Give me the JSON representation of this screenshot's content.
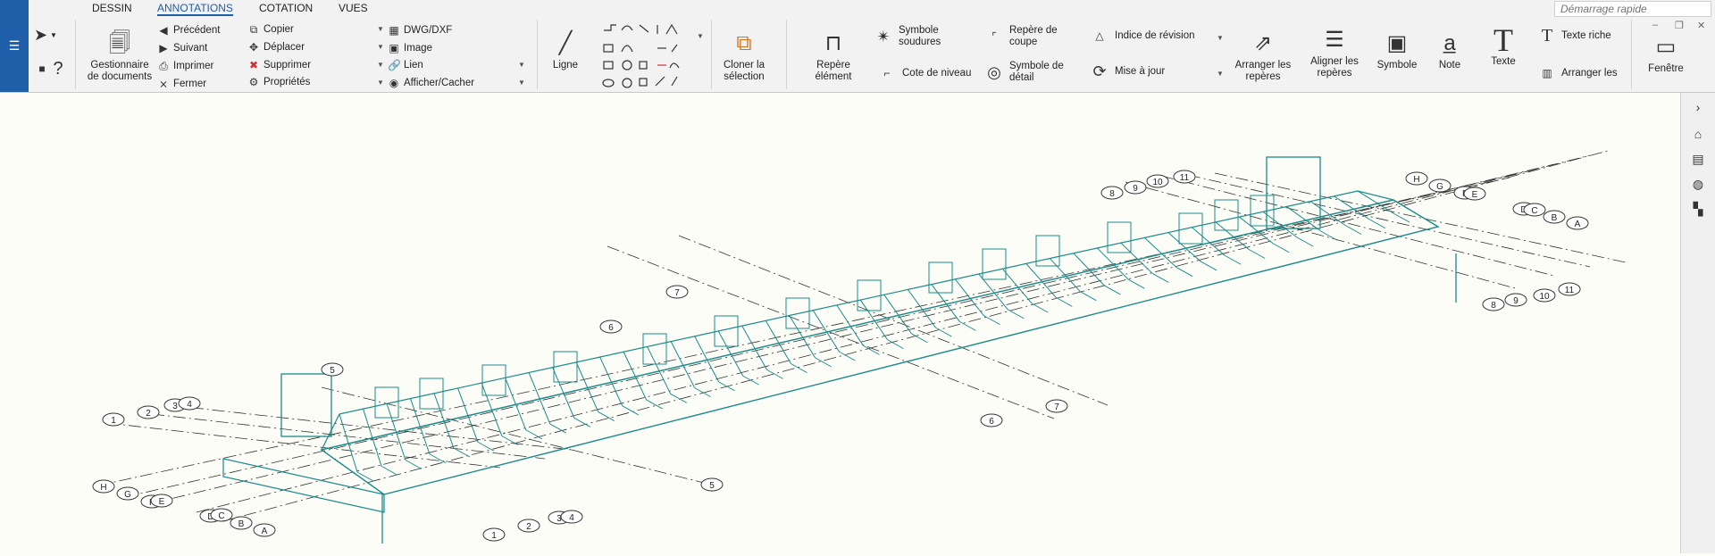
{
  "tabs": [
    "DESSIN",
    "ANNOTATIONS",
    "COTATION",
    "VUES"
  ],
  "active_tab": "ANNOTATIONS",
  "quick_start_placeholder": "Démarrage rapide",
  "window_controls": [
    "–",
    "❐",
    "✕"
  ],
  "toolbar": {
    "documents_manager": [
      "Gestionnaire",
      "de documents"
    ],
    "nav": {
      "previous": "Précédent",
      "next": "Suivant",
      "print": "Imprimer",
      "close": "Fermer"
    },
    "edit": {
      "copy": "Copier",
      "move": "Déplacer",
      "delete": "Supprimer",
      "properties": "Propriétés"
    },
    "insert": {
      "dwg": "DWG/DXF",
      "image": "Image",
      "link": "Lien",
      "show_hide": "Afficher/Cacher"
    },
    "line": "Ligne",
    "clone_selection": [
      "Cloner la",
      "sélection"
    ],
    "element_mark": [
      "Repère",
      "élément"
    ],
    "weld_symbol": [
      "Symbole",
      "soudures"
    ],
    "level_mark": "Cote de niveau",
    "section_mark": [
      "Repère de",
      "coupe"
    ],
    "detail_symbol": [
      "Symbole de",
      "détail"
    ],
    "revision_index": "Indice de révision",
    "update": "Mise à jour",
    "arrange_marks": [
      "Arranger les",
      "repères"
    ],
    "align_marks": [
      "Aligner les",
      "repères"
    ],
    "symbol": "Symbole",
    "note": "Note",
    "text": "Texte",
    "rich_text": "Texte riche",
    "arrange_the": "Arranger les",
    "window": "Fenêtre"
  },
  "grid_labels": {
    "left_numbers": [
      "1",
      "2",
      "3",
      "4"
    ],
    "left_letters": [
      "H",
      "G",
      "F",
      "E",
      "D",
      "C",
      "B",
      "A"
    ],
    "mid_numbers": [
      "5",
      "6",
      "7"
    ],
    "right_numbers": [
      "8",
      "9",
      "10",
      "11"
    ],
    "right_letters": [
      "H",
      "G",
      "F",
      "E",
      "D",
      "C",
      "B",
      "A"
    ]
  },
  "colors": {
    "accent": "#1f5ea8",
    "model": "#1a8a8a",
    "ribbon_bg": "#f2f2f2",
    "canvas_bg": "#fdfdf8"
  }
}
